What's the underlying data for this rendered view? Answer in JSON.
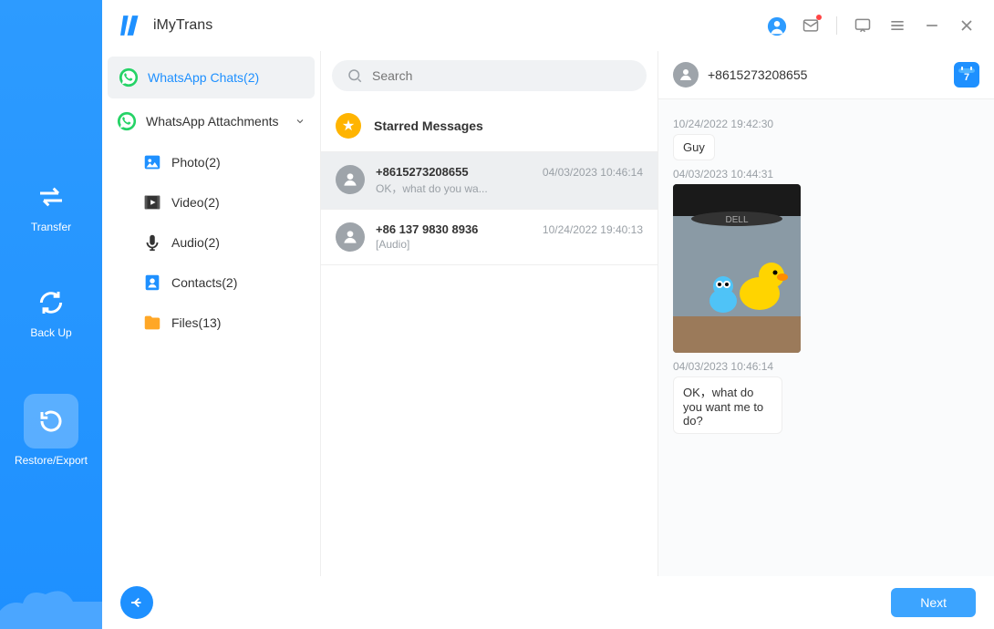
{
  "brand": {
    "name": "iMyTrans"
  },
  "rail": {
    "transfer": "Transfer",
    "backup": "Back Up",
    "restore": "Restore/Export"
  },
  "sidebar": {
    "chats": "WhatsApp Chats(2)",
    "attachments": "WhatsApp Attachments",
    "items": [
      {
        "label": "Photo(2)"
      },
      {
        "label": "Video(2)"
      },
      {
        "label": "Audio(2)"
      },
      {
        "label": "Contacts(2)"
      },
      {
        "label": "Files(13)"
      }
    ]
  },
  "search": {
    "placeholder": "Search"
  },
  "starred": {
    "label": "Starred Messages"
  },
  "conversations": [
    {
      "name": "+8615273208655",
      "time": "04/03/2023 10:46:14",
      "preview": "OK，what do you wa..."
    },
    {
      "name": "+86 137 9830 8936",
      "time": "10/24/2022 19:40:13",
      "preview": "[Audio]"
    }
  ],
  "chat": {
    "title": "+8615273208655",
    "calendar_day": "7",
    "messages": [
      {
        "time": "10/24/2022 19:42:30",
        "text": "Guy",
        "type": "text"
      },
      {
        "time": "04/03/2023 10:44:31",
        "type": "image"
      },
      {
        "time": "04/03/2023 10:46:14",
        "text": "OK，what do you want me to do?",
        "type": "text"
      }
    ]
  },
  "footer": {
    "next": "Next"
  }
}
